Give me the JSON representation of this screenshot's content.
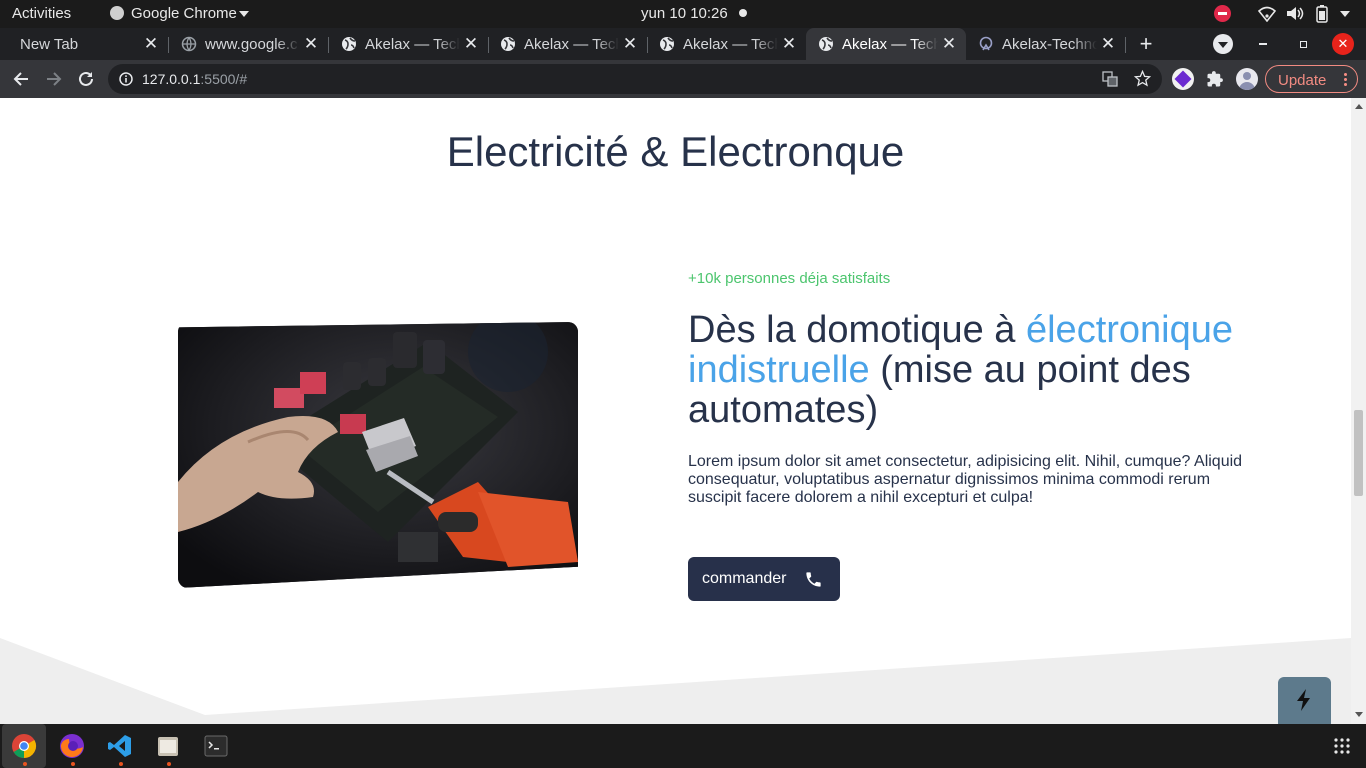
{
  "system": {
    "activities": "Activities",
    "app_name": "Google Chrome",
    "clock": "yun 10  10:26"
  },
  "tabs": [
    {
      "label": "New Tab",
      "active": false
    },
    {
      "label": "www.google.c",
      "active": false
    },
    {
      "label": "Akelax — Tech",
      "active": false
    },
    {
      "label": "Akelax — Tech",
      "active": false
    },
    {
      "label": "Akelax — Tech",
      "active": false
    },
    {
      "label": "Akelax — Tech",
      "active": true
    },
    {
      "label": "Akelax-Techno",
      "active": false
    }
  ],
  "address": {
    "host": "127.0.0.1",
    "path": ":5500/#"
  },
  "update_label": "Update",
  "page": {
    "section_title": "Electricité & Electronque",
    "eyebrow": "+10k personnes déja satisfaits",
    "headline_before": "Dès la domotique à ",
    "headline_highlight": "électronique indistruelle",
    "headline_after": " (mise au point des automates)",
    "body": "Lorem ipsum dolor sit amet consectetur, adipisicing elit. Nihil, cumque? Aliquid consequatur, voluptatibus aspernatur dignissimos minima commodi rerum suscipit facere dolorem a nihil excepturi et culpa!",
    "cta_label": "commander"
  },
  "colors": {
    "accent_blue": "#4aa3e8",
    "accent_green": "#4cc56e",
    "heading_dark": "#27324a",
    "button_dark": "#27304a",
    "fab_bg": "#5d7a8c"
  },
  "icons": {
    "cta": "phone-icon",
    "fab": "lightning-icon"
  }
}
